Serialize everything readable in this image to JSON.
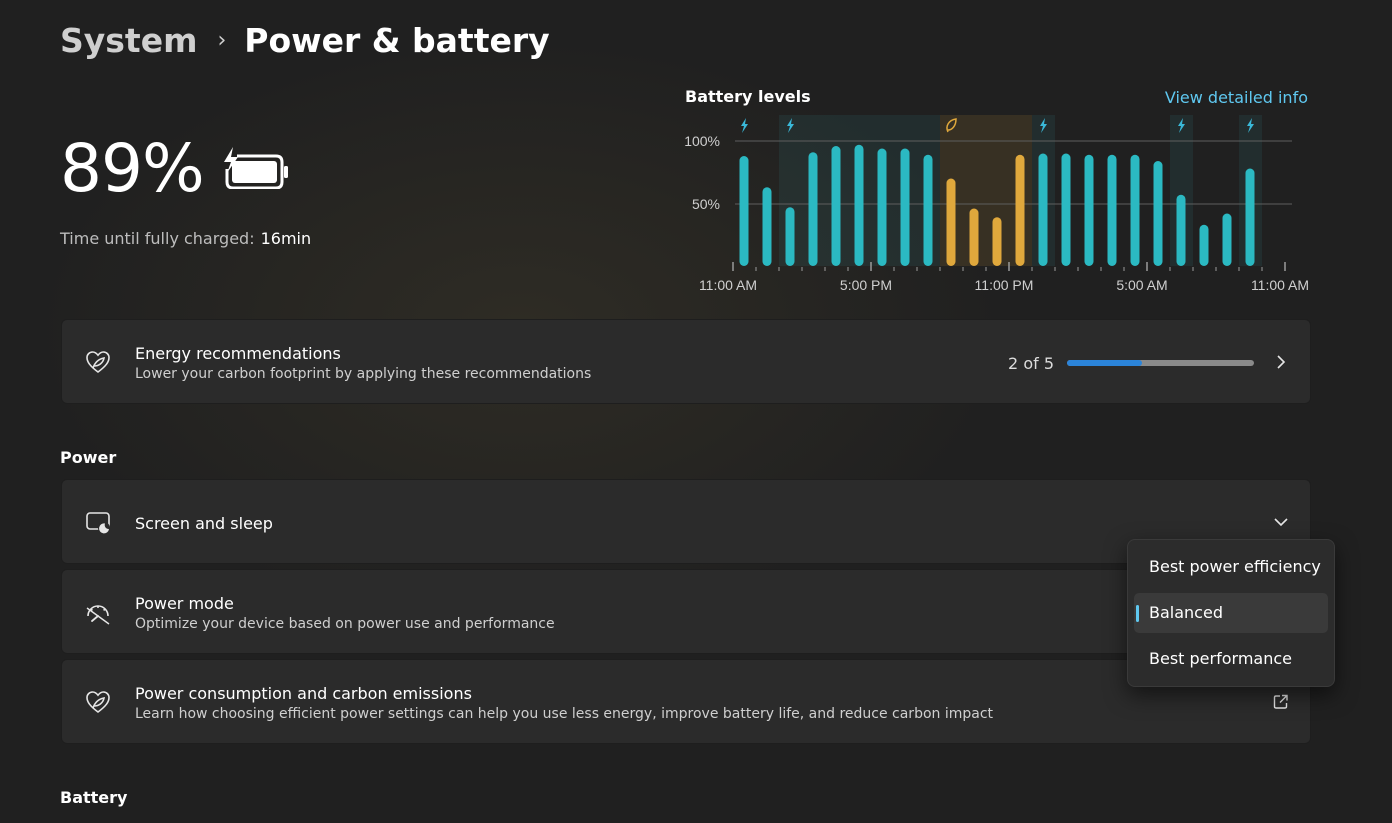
{
  "breadcrumb": {
    "parent": "System",
    "separator": "›",
    "current": "Power & battery"
  },
  "battery": {
    "percentage": "89%",
    "time_label": "Time until fully charged:",
    "time_value": "16min",
    "icon": "battery-charging-icon"
  },
  "chart": {
    "title": "Battery levels",
    "link": "View detailed info",
    "y_ticks": [
      "100%",
      "50%"
    ],
    "x_ticks": [
      "11:00 AM",
      "5:00 PM",
      "11:00 PM",
      "5:00 AM",
      "11:00 AM"
    ]
  },
  "chart_data": {
    "type": "bar",
    "title": "Battery levels",
    "xlabel": "",
    "ylabel": "",
    "ylim": [
      0,
      100
    ],
    "grid": true,
    "categories": [
      "11:00 AM",
      "",
      "",
      "",
      "",
      "",
      "5:00 PM",
      "",
      "",
      "",
      "",
      "",
      "11:00 PM",
      "",
      "",
      "",
      "",
      "",
      "5:00 AM",
      "",
      "",
      "",
      "",
      "",
      "11:00 AM"
    ],
    "values": [
      88,
      63,
      47,
      91,
      96,
      97,
      94,
      94,
      89,
      70,
      46,
      39,
      89,
      90,
      90,
      89,
      89,
      89,
      84,
      57,
      33,
      42,
      78
    ],
    "bar_colors": [
      "teal",
      "teal",
      "teal",
      "teal",
      "teal",
      "teal",
      "teal",
      "teal",
      "teal",
      "amber",
      "amber",
      "amber",
      "amber",
      "teal",
      "teal",
      "teal",
      "teal",
      "teal",
      "teal",
      "teal",
      "teal",
      "teal",
      "teal"
    ],
    "charging_markers": [
      0,
      2,
      13,
      19,
      22
    ],
    "saver_markers": [
      9
    ],
    "colors": {
      "teal": "#2bb9c2",
      "amber": "#e0a83c",
      "charging": "#3ab8d8",
      "saver": "#e0a83c"
    }
  },
  "energy": {
    "title": "Energy recommendations",
    "subtitle": "Lower your carbon footprint by applying these recommendations",
    "progress_text": "2 of 5",
    "progress_fraction": 0.4
  },
  "power_section": {
    "heading": "Power"
  },
  "screen_sleep": {
    "title": "Screen and sleep"
  },
  "power_mode": {
    "title": "Power mode",
    "subtitle": "Optimize your device based on power use and performance",
    "options": [
      "Best power efficiency",
      "Balanced",
      "Best performance"
    ],
    "selected": "Balanced"
  },
  "carbon": {
    "title": "Power consumption and carbon emissions",
    "subtitle": "Learn how choosing efficient power settings can help you use less energy, improve battery life, and reduce carbon impact"
  },
  "battery_section": {
    "heading": "Battery"
  }
}
